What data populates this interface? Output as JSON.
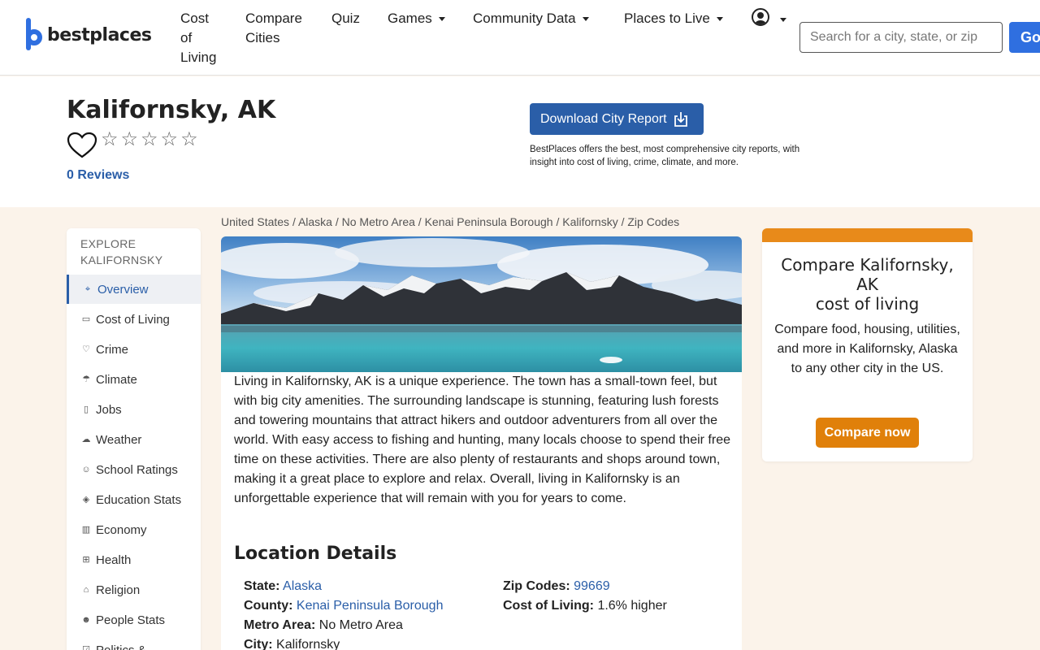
{
  "nav": {
    "logo_text": "bestplaces",
    "items": [
      {
        "label": "Cost of Living",
        "lines": [
          "Cost",
          "of",
          "Living"
        ]
      },
      {
        "label": "Compare Cities",
        "lines": [
          "Compare",
          "Cities"
        ]
      },
      {
        "label": "Quiz"
      },
      {
        "label": "Games"
      },
      {
        "label": "Community Data"
      },
      {
        "label": "Places to Live"
      }
    ],
    "search_placeholder": "Search for a city, state, or zip",
    "go_label": "Go"
  },
  "header": {
    "city_title": "Kalifornsky, AK",
    "reviews": "0 Reviews",
    "rating_stars": 0,
    "download_label": "Download City Report",
    "download_desc": "BestPlaces offers the best, most comprehensive city reports, with insight into cost of living, crime, climate, and more."
  },
  "sidebar": {
    "heading": "EXPLORE KALIFORNSKY",
    "items": [
      {
        "label": "Overview",
        "icon": "map-pin-icon",
        "glyph": "⌖",
        "active": true
      },
      {
        "label": "Cost of Living",
        "icon": "wallet-icon",
        "glyph": "▭"
      },
      {
        "label": "Crime",
        "icon": "shield-icon",
        "glyph": "♡"
      },
      {
        "label": "Climate",
        "icon": "umbrella-icon",
        "glyph": "☂"
      },
      {
        "label": "Jobs",
        "icon": "clipboard-icon",
        "glyph": "▯"
      },
      {
        "label": "Weather",
        "icon": "cloud-rain-icon",
        "glyph": "☁"
      },
      {
        "label": "School Ratings",
        "icon": "school-icon",
        "glyph": "☺"
      },
      {
        "label": "Education Stats",
        "icon": "graduation-cap-icon",
        "glyph": "◈"
      },
      {
        "label": "Economy",
        "icon": "bank-icon",
        "glyph": "▥"
      },
      {
        "label": "Health",
        "icon": "medical-kit-icon",
        "glyph": "⊞"
      },
      {
        "label": "Religion",
        "icon": "church-icon",
        "glyph": "⌂"
      },
      {
        "label": "People Stats",
        "icon": "people-icon",
        "glyph": "☻"
      },
      {
        "label": "Politics &",
        "icon": "vote-icon",
        "glyph": "☑"
      }
    ]
  },
  "breadcrumb": "United States / Alaska / No Metro Area / Kenai Peninsula Borough / Kalifornsky / Zip Codes",
  "main": {
    "intro": "Living in Kalifornsky, AK is a unique experience. The town has a small-town feel, but with big city amenities. The surrounding landscape is stunning, featuring lush forests and towering mountains that attract hikers and outdoor adventurers from all over the world. With easy access to fishing and hunting, many locals choose to spend their free time on these activities. There are also plenty of restaurants and shops around town, making it a great place to explore and relax. Overall, living in Kalifornsky is an unforgettable experience that will remain with you for years to come.",
    "location_title": "Location Details",
    "details": {
      "state_label": "State:",
      "state_value": "Alaska",
      "county_label": "County:",
      "county_value": "Kenai Peninsula Borough",
      "metro_label": "Metro Area:",
      "metro_value": "No Metro Area",
      "city_label": "City:",
      "city_value": "Kalifornsky",
      "zip_label": "Zip Codes:",
      "zip_value": "99669",
      "col_label": "Cost of Living:",
      "col_value": "1.6% higher"
    }
  },
  "compare": {
    "title_line1": "Compare Kalifornsky,",
    "title_line2": "AK",
    "title_line3": "cost of living",
    "desc": "Compare food, housing, utilities, and more in Kalifornsky, Alaska to any other city in the US.",
    "button": "Compare now"
  },
  "colors": {
    "brand_blue": "#2a5ea8",
    "logo_blue": "#2f6fe0",
    "accent_orange": "#e0800a",
    "page_bg": "#fbf3ea"
  }
}
